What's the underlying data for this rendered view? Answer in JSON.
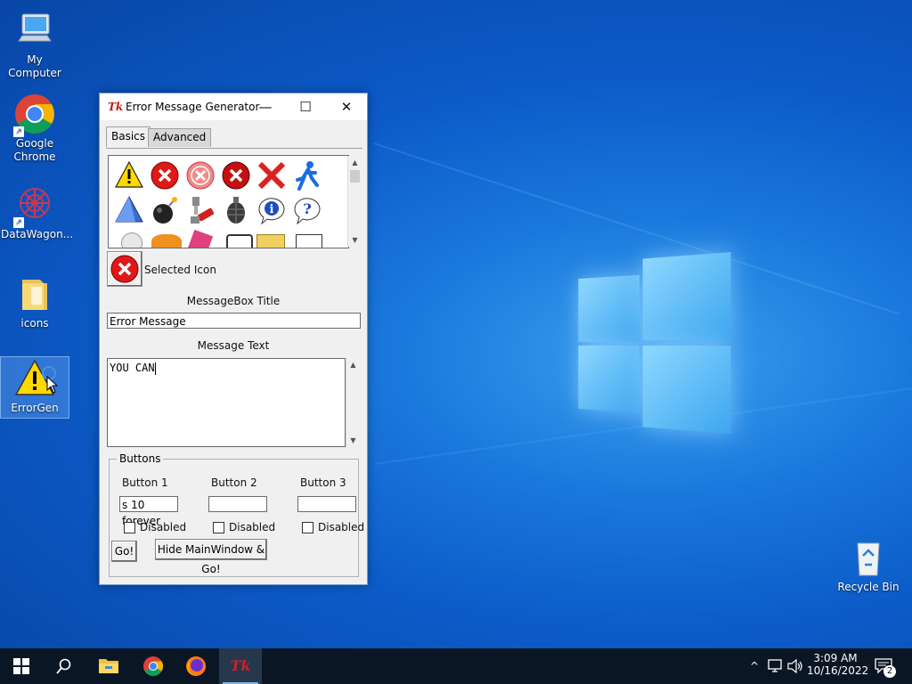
{
  "desktop": {
    "icons": [
      {
        "label": "My Computer"
      },
      {
        "label": "Google Chrome"
      },
      {
        "label": "DataWagon..."
      },
      {
        "label": "icons"
      },
      {
        "label": "ErrorGen"
      },
      {
        "label": "Recycle Bin"
      }
    ]
  },
  "window": {
    "title": "Error Message Generator",
    "app_icon_text": "Tk",
    "controls": {
      "minimize": "—",
      "maximize": "☐",
      "close": "✕"
    },
    "tabs": [
      {
        "label": "Basics",
        "active": true
      },
      {
        "label": "Advanced",
        "active": false
      }
    ],
    "icon_grid": {
      "row1": [
        "warning-icon",
        "error-red-icon",
        "error-faded-icon",
        "error-dark-icon",
        "red-x-icon",
        "running-man-icon"
      ],
      "row2": [
        "blue-pyramid-icon",
        "bomb-icon",
        "tool-icon",
        "grenade-icon",
        "info-bubble-icon",
        "question-bubble-icon"
      ]
    },
    "selected_icon_label": "Selected Icon",
    "messagebox_title_label": "MessageBox Title",
    "messagebox_title_value": "Error Message",
    "message_text_label": "Message Text",
    "message_text_value": "YOU CAN",
    "buttons_group": {
      "legend": "Buttons",
      "button1_label": "Button 1",
      "button2_label": "Button 2",
      "button3_label": "Button 3",
      "button1_value": "s 10 forever",
      "button2_value": "",
      "button3_value": "",
      "disabled_label": "Disabled",
      "go_label": "Go!",
      "hide_go_label": "Hide MainWindow & Go!"
    }
  },
  "taskbar": {
    "time": "3:09 AM",
    "date": "10/16/2022",
    "notification_count": "2",
    "tray_chevron": "^"
  },
  "colors": {
    "error_red": "#d42020",
    "warning_yellow": "#ffd800",
    "taskbar": "#0b1624"
  }
}
